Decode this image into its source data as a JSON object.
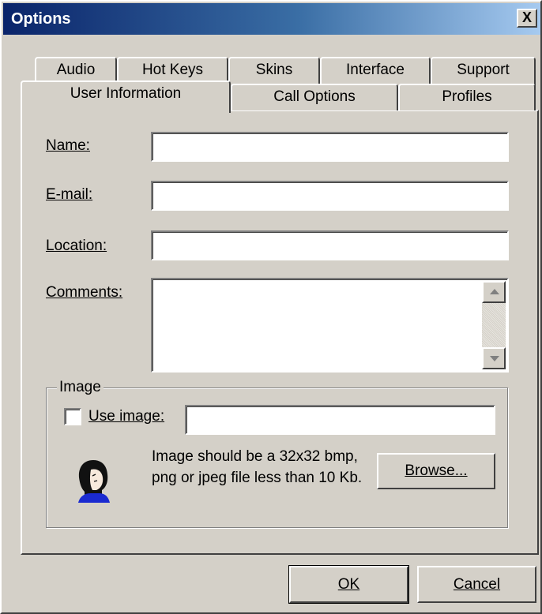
{
  "window": {
    "title": "Options",
    "close_label": "X"
  },
  "tabs": {
    "row1": [
      "Audio",
      "Hot Keys",
      "Skins",
      "Interface",
      "Support"
    ],
    "row2": [
      "User Information",
      "Call Options",
      "Profiles"
    ],
    "active": "User Information"
  },
  "form": {
    "name_label": "Name:",
    "name_value": "",
    "email_label": "E-mail:",
    "email_value": "",
    "location_label": "Location:",
    "location_value": "",
    "comments_label": "Comments:",
    "comments_value": ""
  },
  "image_group": {
    "legend": "Image",
    "use_image_label": "Use image:",
    "use_image_checked": false,
    "path_value": "",
    "hint": "Image should be a 32x32 bmp, png or jpeg file less than 10 Kb.",
    "browse_label": "Browse...",
    "icon": "user-avatar-icon"
  },
  "buttons": {
    "ok": "OK",
    "cancel": "Cancel"
  },
  "colors": {
    "titlebar_start": "#0a246a",
    "titlebar_end": "#a6caf0",
    "face": "#d4d0c8"
  }
}
